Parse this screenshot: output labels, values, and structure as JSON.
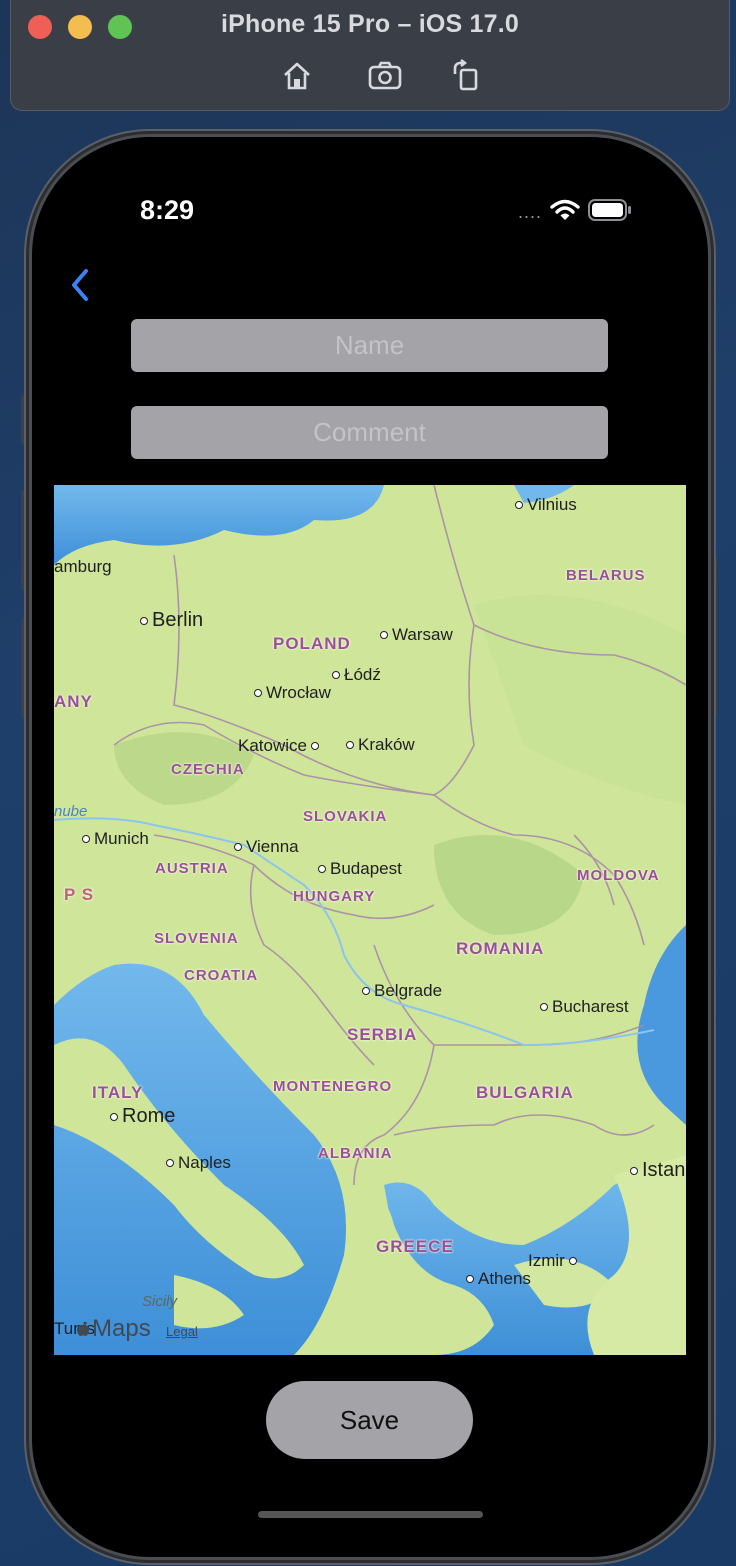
{
  "simulator": {
    "title": "iPhone 15 Pro – iOS 17.0",
    "tools": [
      "home-icon",
      "screenshot-icon",
      "rotate-icon"
    ]
  },
  "status_bar": {
    "time": "8:29",
    "signal": "....",
    "icons": [
      "wifi-icon",
      "battery-icon"
    ]
  },
  "nav": {
    "back_icon": "chevron-left-icon",
    "accent": "#3b82f6"
  },
  "form": {
    "name_placeholder": "Name",
    "name_value": "",
    "comment_placeholder": "Comment",
    "comment_value": ""
  },
  "map": {
    "cities": {
      "vilnius": "Vilnius",
      "hamburg": "amburg",
      "berlin": "Berlin",
      "warsaw": "Warsaw",
      "lodz": "Łódź",
      "wroclaw": "Wrocław",
      "katowice": "Katowice",
      "krakow": "Kraków",
      "munich": "Munich",
      "vienna": "Vienna",
      "budapest": "Budapest",
      "belgrade": "Belgrade",
      "bucharest": "Bucharest",
      "rome": "Rome",
      "naples": "Naples",
      "istanbul": "Istan",
      "izmir": "Izmir",
      "athens": "Athens",
      "tunis": "Tunis"
    },
    "countries": {
      "belarus": "BELARUS",
      "poland": "POLAND",
      "germany": "ANY",
      "czechia": "CZECHIA",
      "slovakia": "SLOVAKIA",
      "austria": "AUSTRIA",
      "hungary": "HUNGARY",
      "moldova": "MOLDOVA",
      "slovenia": "SLOVENIA",
      "croatia": "CROATIA",
      "romania": "ROMANIA",
      "serbia": "SERBIA",
      "montenegro": "MONTENEGRO",
      "bulgaria": "BULGARIA",
      "italy": "ITALY",
      "albania": "ALBANIA",
      "greece": "GREECE"
    },
    "labels": {
      "danube": "nube",
      "sicily": "Sicily",
      "alps": "P S"
    },
    "attribution": {
      "logo": "Maps",
      "legal": "Legal"
    }
  },
  "actions": {
    "save_label": "Save"
  }
}
